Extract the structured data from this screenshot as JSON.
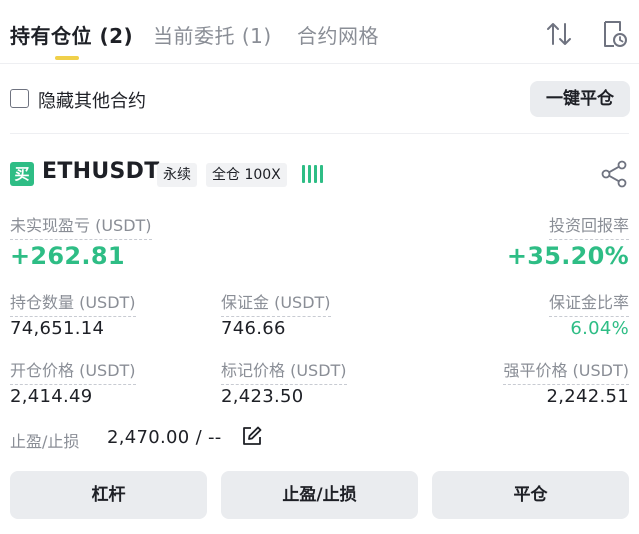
{
  "tabs": [
    {
      "label": "持有仓位 (2)"
    },
    {
      "label": "当前委托 (1)"
    },
    {
      "label": "合约网格"
    }
  ],
  "filter": {
    "hide_others_label": "隐藏其他合约",
    "hide_others_checked": false,
    "close_all_label": "一键平仓"
  },
  "position": {
    "side": "买",
    "symbol": "ETHUSDT",
    "type_tag": "永续",
    "margin_tag": "全仓 100X",
    "unrealized_pnl_label": "未实现盈亏 (USDT)",
    "unrealized_pnl": "+262.81",
    "roi_label": "投资回报率",
    "roi": "+35.20%",
    "size_label": "持仓数量 (USDT)",
    "size": "74,651.14",
    "margin_label": "保证金 (USDT)",
    "margin": "746.66",
    "margin_ratio_label": "保证金比率",
    "margin_ratio": "6.04%",
    "entry_price_label": "开仓价格 (USDT)",
    "entry_price": "2,414.49",
    "mark_price_label": "标记价格 (USDT)",
    "mark_price": "2,423.50",
    "liq_price_label": "强平价格 (USDT)",
    "liq_price": "2,242.51",
    "tpsl_label": "止盈/止损",
    "tpsl_value": "2,470.00 / --"
  },
  "actions": {
    "leverage_label": "杠杆",
    "tpsl_label": "止盈/止损",
    "close_label": "平仓"
  },
  "icons": {
    "sort": "sort-arrows-icon",
    "history": "document-clock-icon",
    "share": "share-icon",
    "edit": "edit-icon",
    "adl": "adl-indicator-icon"
  },
  "colors": {
    "profit_green": "#2ebd85",
    "accent_yellow": "#f0d04a",
    "button_gray": "#eaecef"
  }
}
